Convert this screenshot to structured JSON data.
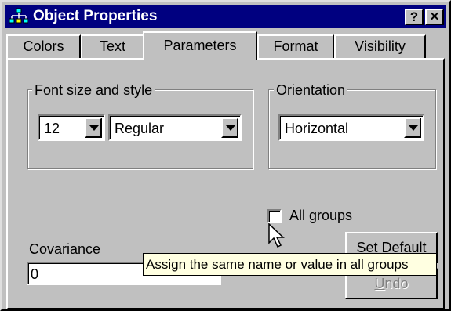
{
  "window": {
    "title": "Object Properties",
    "help_label": "?",
    "close_label": "✕",
    "icon": "hierarchy-icon"
  },
  "tabs": [
    {
      "label": "Colors",
      "active": false
    },
    {
      "label": "Text",
      "active": false
    },
    {
      "label": "Parameters",
      "active": true
    },
    {
      "label": "Format",
      "active": false
    },
    {
      "label": "Visibility",
      "active": false
    }
  ],
  "font_group": {
    "label_mnemonic": "F",
    "label_rest": "ont size and style",
    "size_value": "12",
    "style_value": "Regular"
  },
  "orientation_group": {
    "label_mnemonic": "O",
    "label_rest": "rientation",
    "value": "Horizontal"
  },
  "all_groups": {
    "label": "All groups",
    "checked": false
  },
  "covariance": {
    "label_mnemonic": "C",
    "label_rest": "ovariance",
    "value": "0"
  },
  "buttons": {
    "set_default": "Set Default",
    "undo_mnemonic": "U",
    "undo_rest": "ndo"
  },
  "tooltip": {
    "text": "Assign the same name or value in all groups"
  },
  "colors": {
    "titlebar": "#000080",
    "face": "#c0c0c0",
    "tooltip_bg": "#ffffe1"
  }
}
